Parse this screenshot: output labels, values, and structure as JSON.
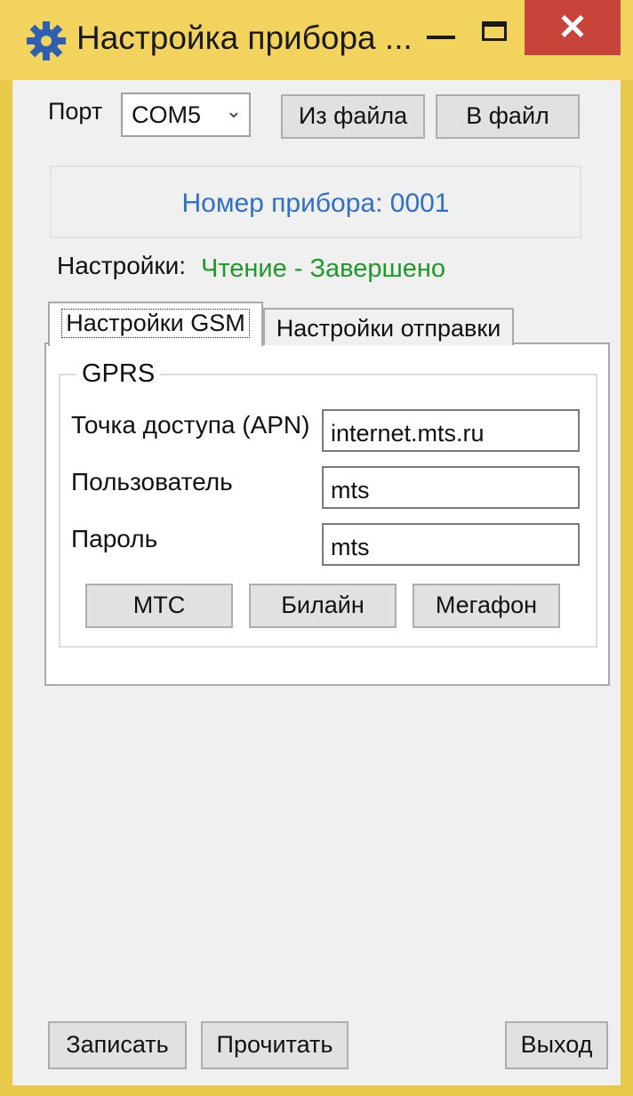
{
  "window": {
    "title": "Настройка прибора ...",
    "icons": {
      "app": "gear-icon",
      "minimize": "minimize-icon",
      "maximize": "maximize-icon",
      "close": "close-icon"
    },
    "close_glyph": "✕"
  },
  "port": {
    "label": "Порт",
    "selected": "COM5",
    "from_file_label": "Из файла",
    "to_file_label": "В файл"
  },
  "device": {
    "number_text": "Номер прибора: 0001"
  },
  "settings_status": {
    "label": "Настройки:",
    "value": "Чтение - Завершено",
    "color": "#1e9a2a"
  },
  "tabs": [
    {
      "label": "Настройки GSM",
      "active": true
    },
    {
      "label": "Настройки отправки",
      "active": false
    }
  ],
  "gprs": {
    "title": "GPRS",
    "apn_label": "Точка доступа (APN)",
    "apn_value": "internet.mts.ru",
    "user_label": "Пользователь",
    "user_value": "mts",
    "password_label": "Пароль",
    "password_value": "mts",
    "presets": [
      "МТС",
      "Билайн",
      "Мегафон"
    ]
  },
  "footer": {
    "write_label": "Записать",
    "read_label": "Прочитать",
    "exit_label": "Выход"
  },
  "colors": {
    "accent_blue": "#2f6fc8",
    "close_red": "#c8443b",
    "frame_yellow": "#f2d35e"
  }
}
